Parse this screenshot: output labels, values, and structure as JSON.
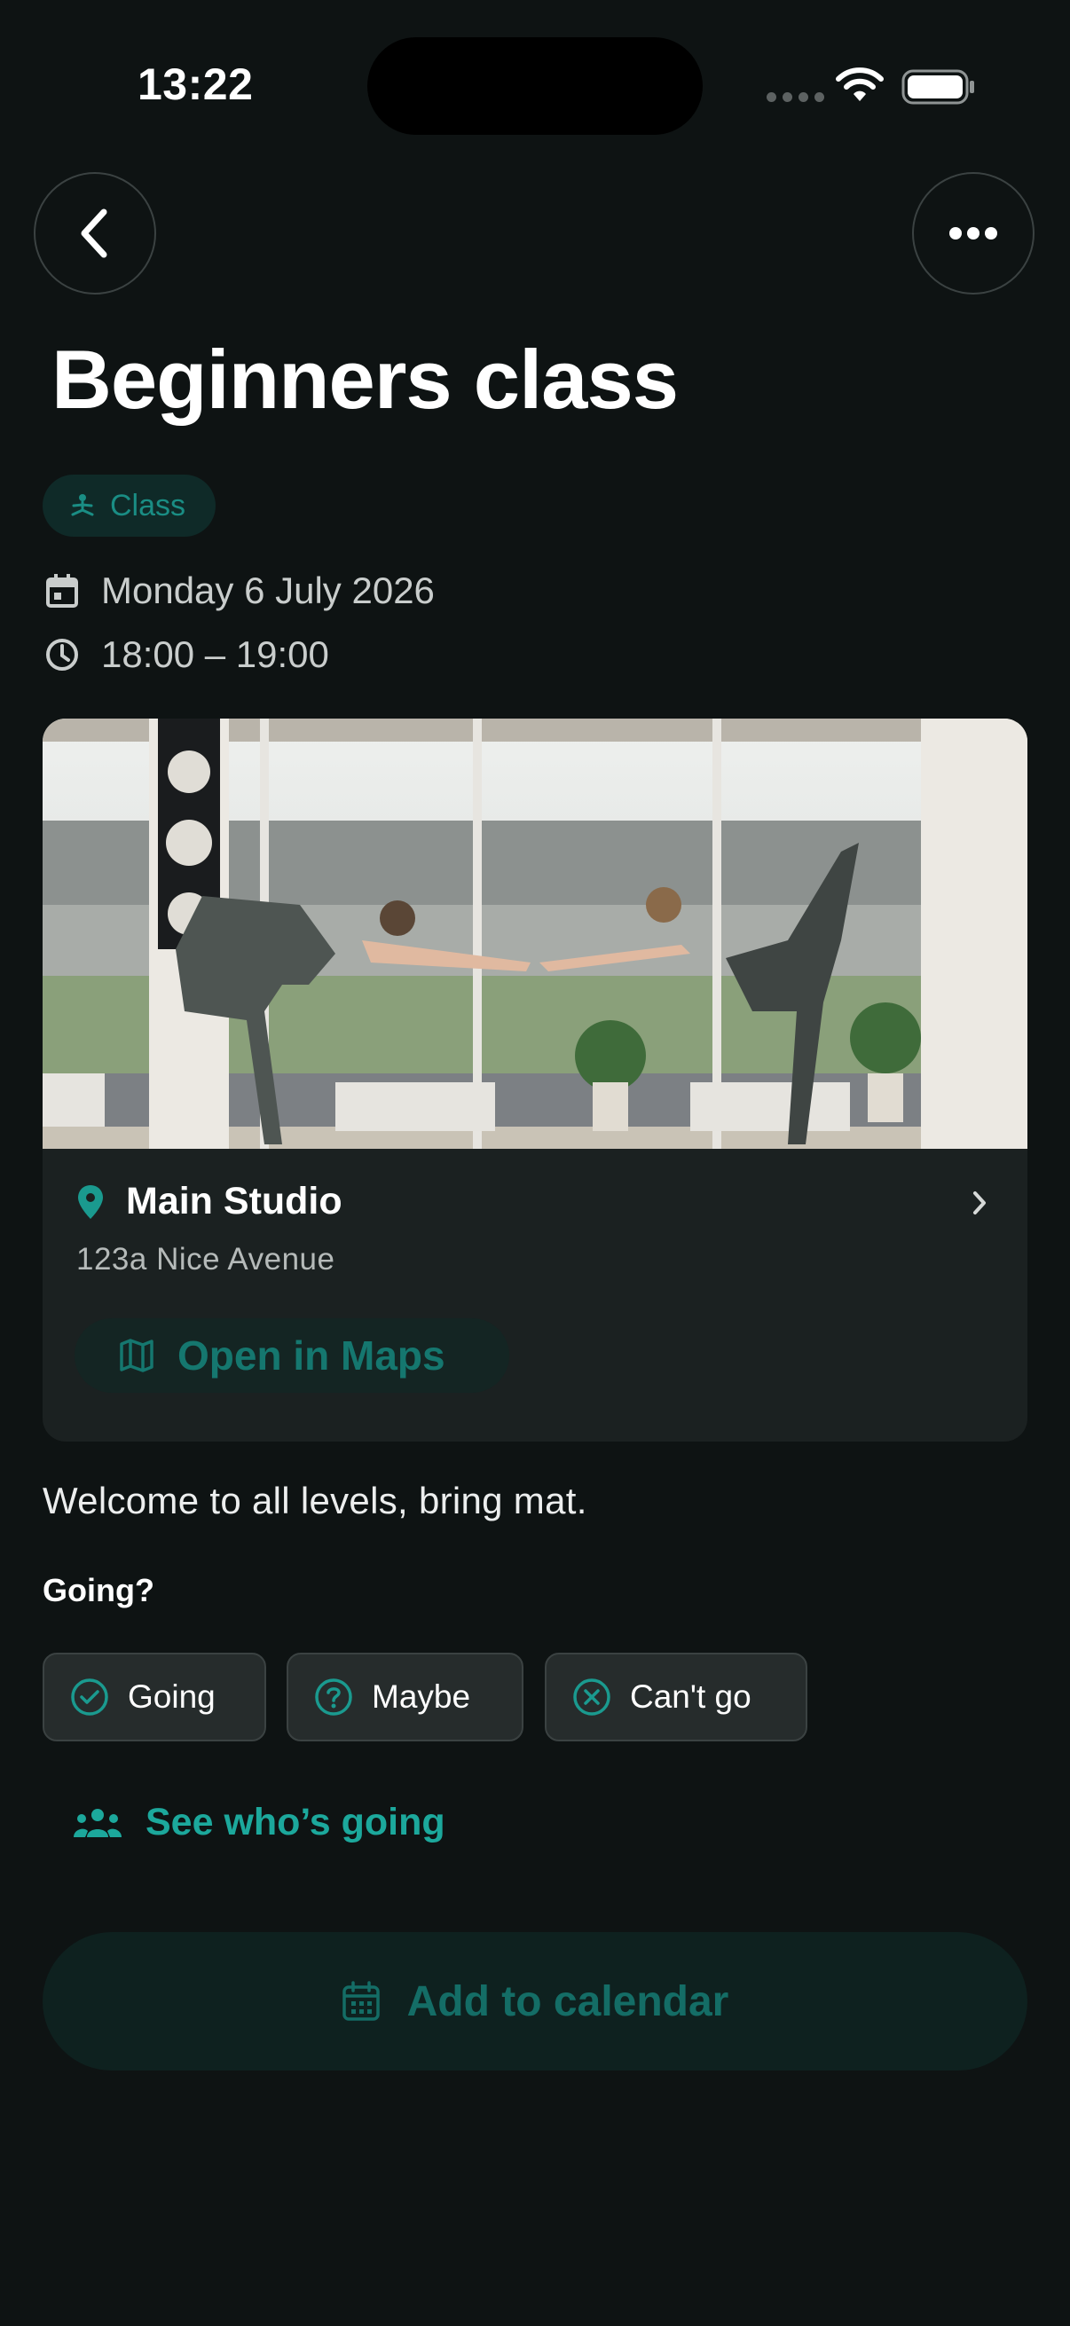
{
  "status_bar": {
    "time": "13:22"
  },
  "event": {
    "title": "Beginners class",
    "category": "Class",
    "date": "Monday 6 July 2026",
    "time_range": "18:00 – 19:00"
  },
  "location": {
    "name": "Main Studio",
    "address": "123a Nice Avenue",
    "maps_label": "Open in Maps"
  },
  "description": "Welcome to all levels, bring mat.",
  "rsvp": {
    "label": "Going?",
    "options": [
      "Going",
      "Maybe",
      "Can't go"
    ]
  },
  "attendees_link": "See who’s going",
  "calendar_button": "Add to calendar",
  "icons": {
    "back": "chevron-left-icon",
    "more": "ellipsis-icon",
    "category": "meditation-icon",
    "date": "calendar-icon",
    "time": "clock-icon",
    "location": "map-pin-icon",
    "maps": "map-icon",
    "attendees": "people-icon",
    "add_calendar": "calendar-grid-icon"
  },
  "colors": {
    "background": "#0e1313",
    "accent": "#1ca89c",
    "card": "#1b2121"
  }
}
